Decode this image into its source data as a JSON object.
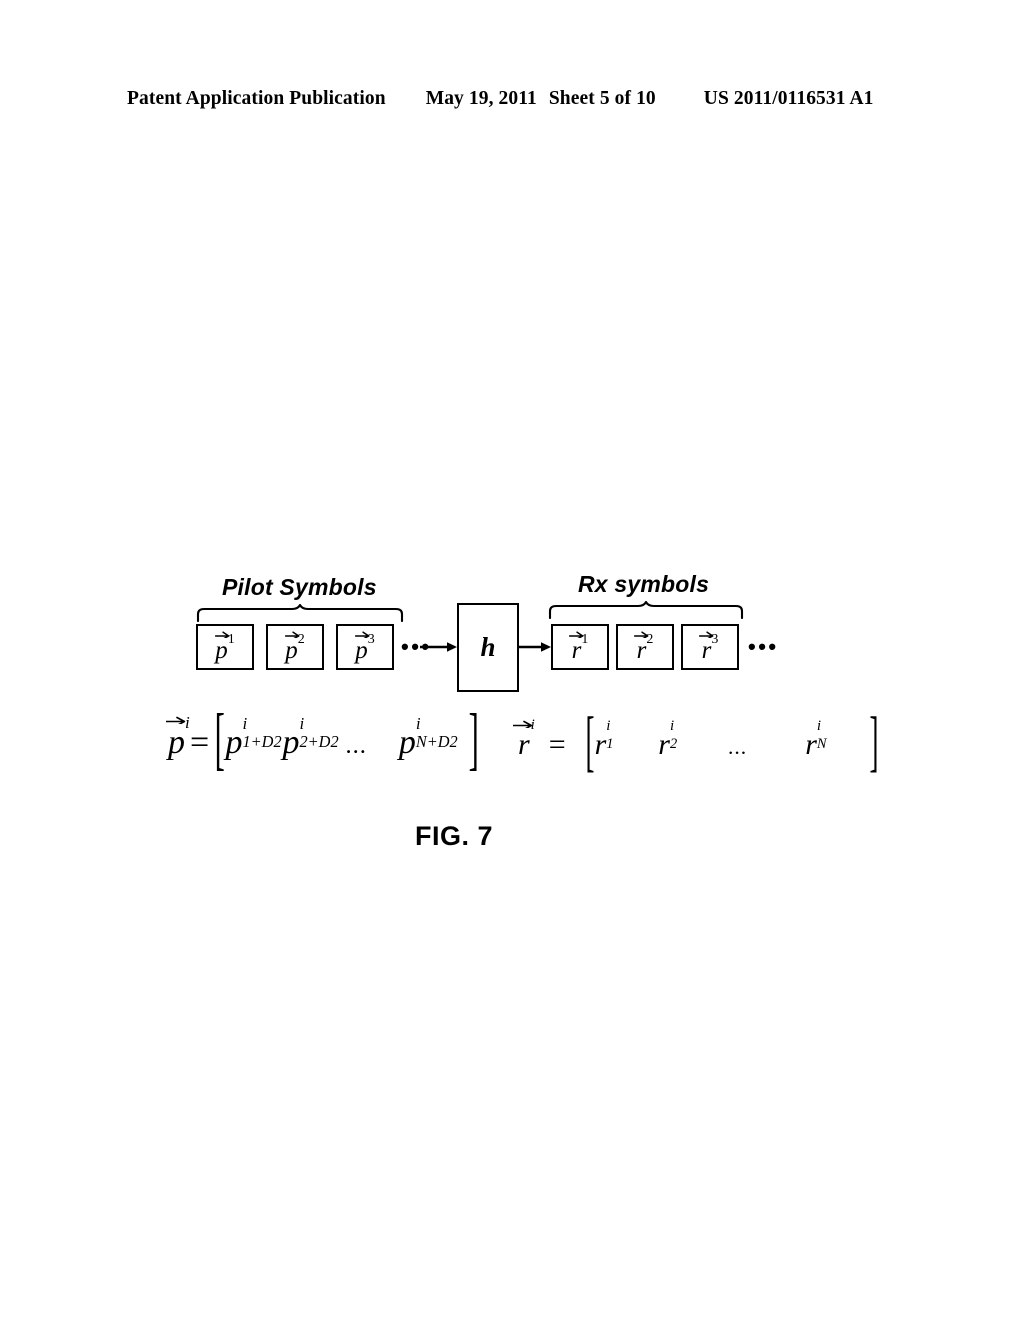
{
  "header": {
    "publication": "Patent Application Publication",
    "date": "May 19, 2011",
    "sheet": "Sheet 5 of 10",
    "patent_number": "US 2011/0116531 A1"
  },
  "figure": {
    "caption": "FIG. 7",
    "pilot_group_label": "Pilot Symbols",
    "rx_group_label": "Rx symbols",
    "channel_label": "h",
    "pilot_boxes": [
      {
        "letter": "p",
        "superscript": "1"
      },
      {
        "letter": "p",
        "superscript": "2"
      },
      {
        "letter": "p",
        "superscript": "3"
      }
    ],
    "rx_boxes": [
      {
        "letter": "r",
        "superscript": "1"
      },
      {
        "letter": "r",
        "superscript": "2"
      },
      {
        "letter": "r",
        "superscript": "3"
      }
    ],
    "pilot_ellipsis": "•••",
    "rx_ellipsis": "•••",
    "equations": {
      "pilot": {
        "lhs_letter": "p",
        "lhs_superscript": "i",
        "equals": "=",
        "open_bracket": "[",
        "close_bracket": "]",
        "terms": [
          {
            "letter": "p",
            "superscript": "i",
            "subscript": "1+D2"
          },
          {
            "letter": "p",
            "superscript": "i",
            "subscript": "2+D2"
          },
          {
            "letter": "p",
            "superscript": "i",
            "subscript": "N+D2"
          }
        ],
        "dots": "..."
      },
      "rx": {
        "lhs_letter": "r",
        "lhs_superscript": "i",
        "equals": "=",
        "open_bracket": "[",
        "close_bracket": "]",
        "terms": [
          {
            "letter": "r",
            "superscript": "i",
            "subscript": "1"
          },
          {
            "letter": "r",
            "superscript": "i",
            "subscript": "2"
          },
          {
            "letter": "r",
            "superscript": "i",
            "subscript": "N"
          }
        ],
        "dots": "..."
      }
    }
  },
  "colors": {
    "page_background": "#ffffff",
    "ink": "#000000"
  }
}
